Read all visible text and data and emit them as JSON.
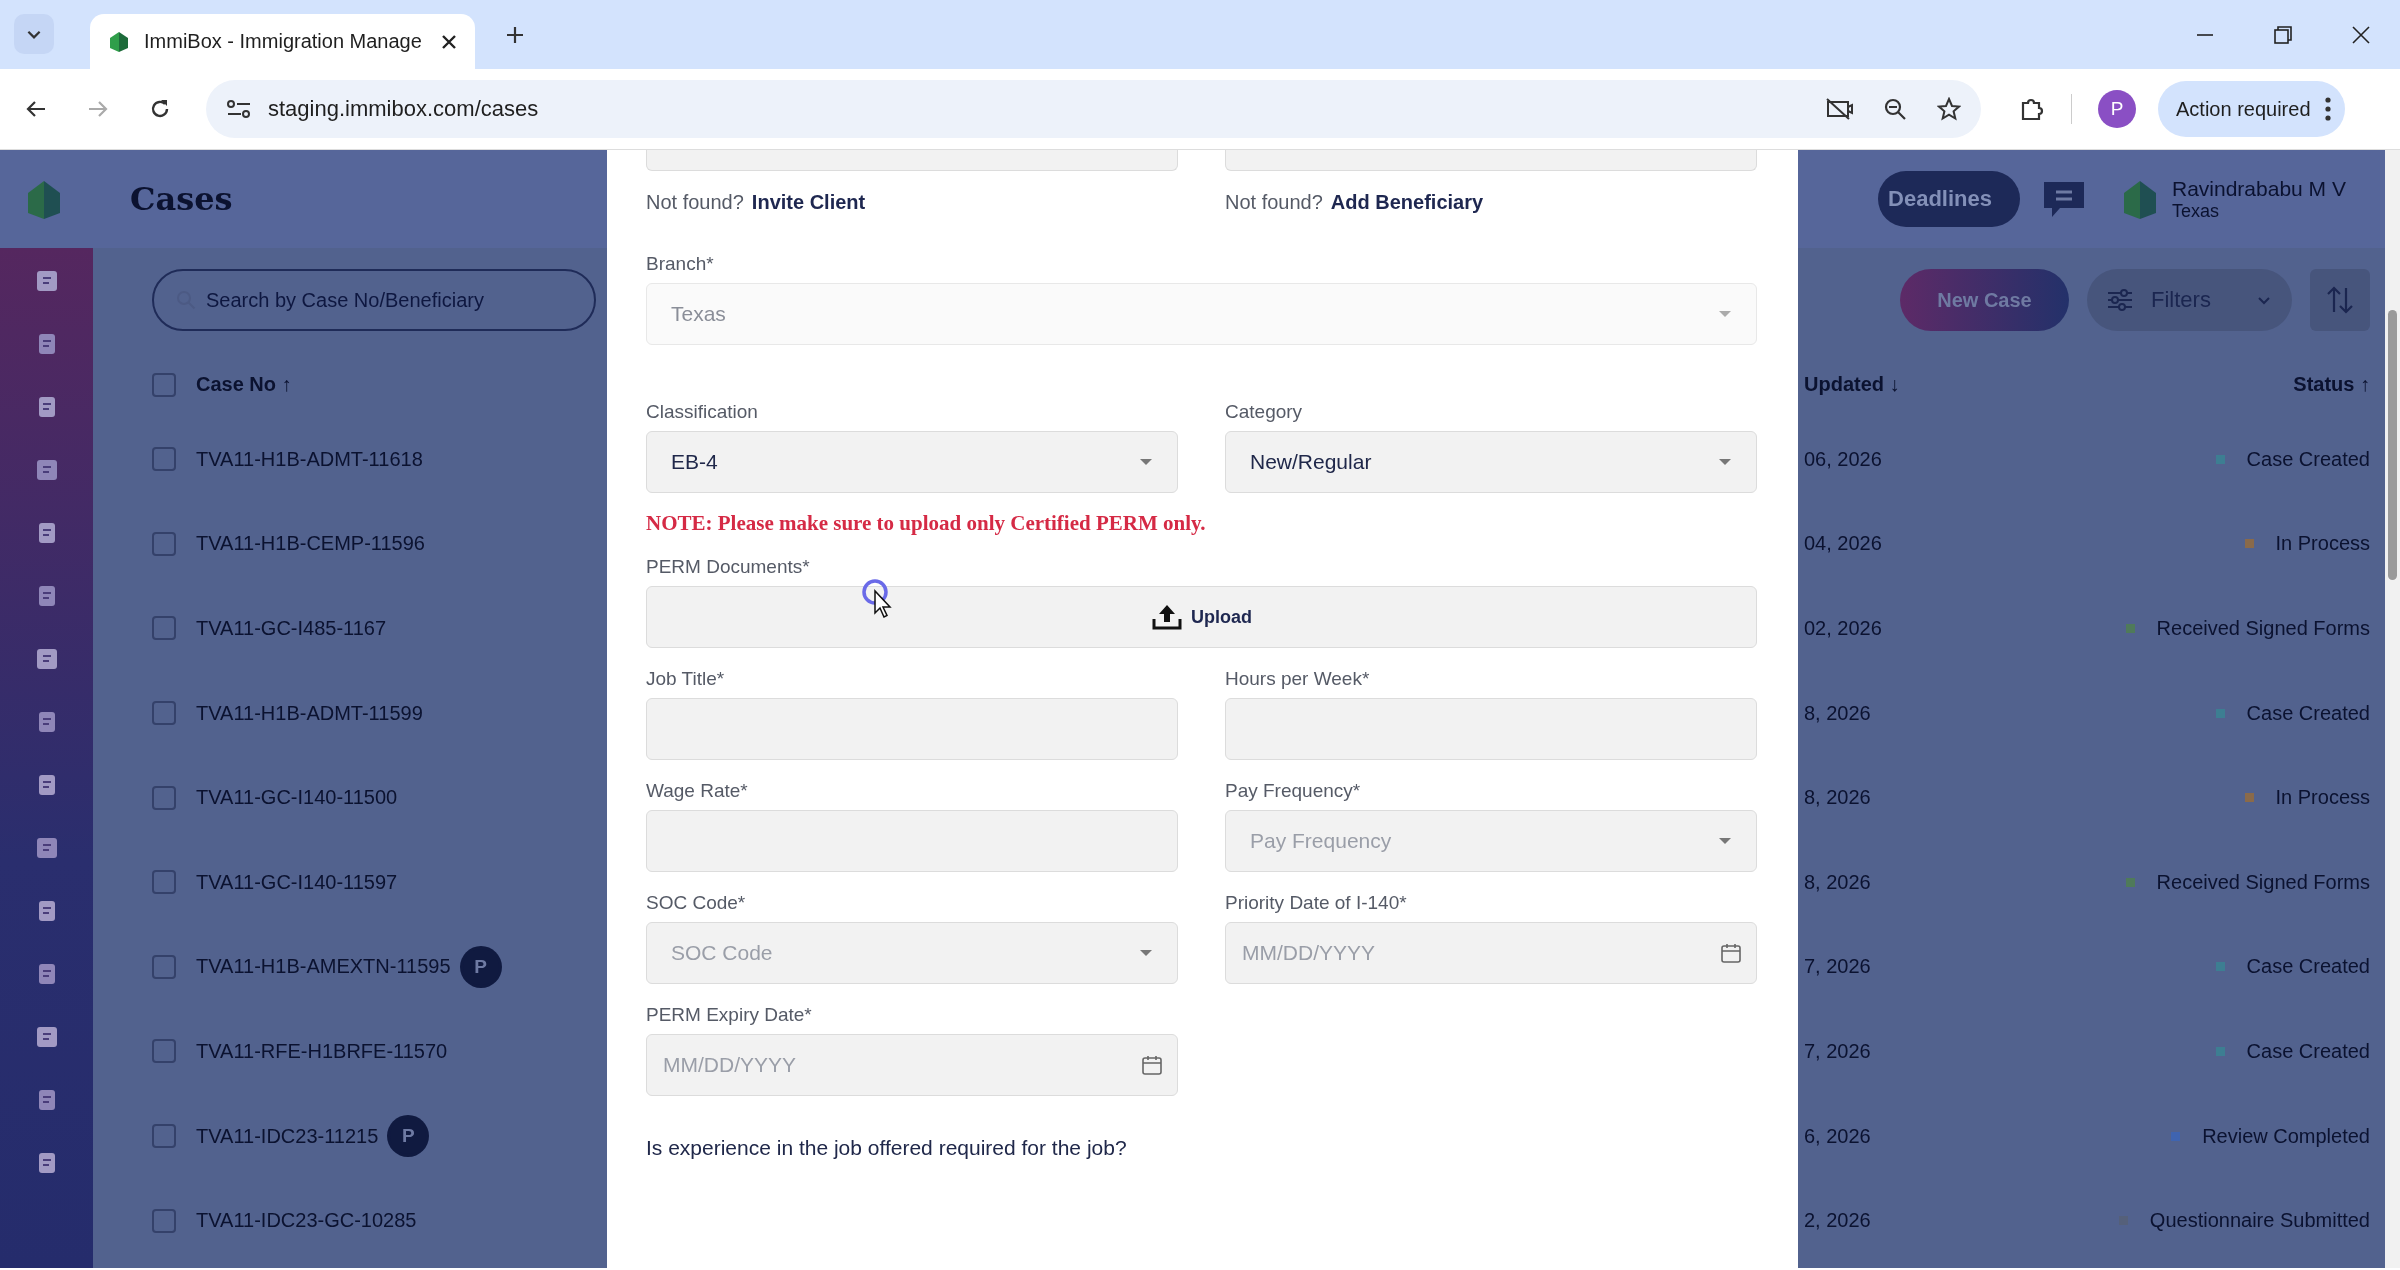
{
  "browser": {
    "tab_title": "ImmiBox - Immigration Manage",
    "url": "staging.immibox.com/cases",
    "profile_initial": "P",
    "action_button": "Action required"
  },
  "app": {
    "title": "Cases",
    "deadlines_button": "Deadlines",
    "user": {
      "name": "Ravindrababu M V",
      "branch": "Texas"
    },
    "search": {
      "placeholder": "Search by Case No/Beneficiary"
    },
    "new_case_button": "New Case",
    "filters_button": "Filters",
    "table": {
      "columns": [
        "Case No ↑",
        "Updated ↓",
        "Status ↑"
      ],
      "all_checked": false,
      "rows": [
        {
          "checked": false,
          "case_no": "TVA11-H1B-ADMT-11618",
          "updated": "06, 2026",
          "status": "Case Created",
          "color": "#3d7e92"
        },
        {
          "checked": false,
          "case_no": "TVA11-H1B-CEMP-11596",
          "updated": "04, 2026",
          "status": "In Process",
          "color": "#8a6a4a"
        },
        {
          "checked": false,
          "case_no": "TVA11-GC-I485-1167",
          "updated": "02, 2026",
          "status": "Received Signed Forms",
          "color": "#4f7a5a"
        },
        {
          "checked": false,
          "case_no": "TVA11-H1B-ADMT-11599",
          "updated": "8, 2026",
          "status": "Case Created",
          "color": "#3d7e92"
        },
        {
          "checked": false,
          "case_no": "TVA11-GC-I140-11500",
          "updated": "8, 2026",
          "status": "In Process",
          "color": "#8a6a4a"
        },
        {
          "checked": false,
          "case_no": "TVA11-GC-I140-11597",
          "updated": "8, 2026",
          "status": "Received Signed Forms",
          "color": "#4f7a5a"
        },
        {
          "checked": false,
          "case_no": "TVA11-H1B-AMEXTN-11595",
          "badge": "P",
          "updated": "7, 2026",
          "status": "Case Created",
          "color": "#3d7e92"
        },
        {
          "checked": false,
          "case_no": "TVA11-RFE-H1BRFE-11570",
          "updated": "7, 2026",
          "status": "Case Created",
          "color": "#3d7e92"
        },
        {
          "checked": false,
          "case_no": "TVA11-IDC23-11215",
          "badge": "P",
          "updated": "6, 2026",
          "status": "Review Completed",
          "color": "#3f64b0"
        },
        {
          "checked": false,
          "case_no": "TVA11-IDC23-GC-10285",
          "updated": "2, 2026",
          "status": "Questionnaire Submitted",
          "color": "#55607a"
        }
      ]
    }
  },
  "modal": {
    "links": [
      {
        "prompt": "Not found?",
        "link": "Invite Client"
      },
      {
        "prompt": "Not found?",
        "link": "Add Beneficiary"
      }
    ],
    "rows": [
      {
        "kind": "wide_field",
        "fields": [
          {
            "label": "Branch*",
            "kind": "select",
            "value": "Texas",
            "disabled": true
          }
        ]
      },
      {
        "kind": "fields",
        "fields": [
          {
            "label": "Classification",
            "kind": "select",
            "value": "EB-4",
            "disabled": false
          },
          {
            "label": "Category",
            "kind": "select",
            "value": "New/Regular",
            "disabled": false
          }
        ]
      },
      {
        "kind": "note",
        "text": "NOTE: Please make sure to upload only Certified PERM only."
      },
      {
        "kind": "wide_field",
        "fields": [
          {
            "label": "PERM Documents*",
            "kind": "upload",
            "value": "Upload",
            "disabled": false
          }
        ]
      },
      {
        "kind": "fields",
        "fields": [
          {
            "label": "Job Title*",
            "kind": "text",
            "disabled": false
          },
          {
            "label": "Hours per Week*",
            "kind": "text",
            "disabled": false
          }
        ]
      },
      {
        "kind": "fields",
        "fields": [
          {
            "label": "Wage Rate*",
            "kind": "text",
            "disabled": false
          },
          {
            "label": "Pay Frequency*",
            "kind": "select",
            "placeholder": "Pay Frequency",
            "disabled": false
          }
        ]
      },
      {
        "kind": "fields",
        "fields": [
          {
            "label": "SOC Code*",
            "kind": "select",
            "placeholder": "SOC Code",
            "disabled": false
          },
          {
            "label": "Priority Date of I-140*",
            "kind": "date",
            "placeholder": "MM/DD/YYYY",
            "disabled": false
          }
        ]
      },
      {
        "kind": "fields",
        "fields": [
          {
            "label": "PERM Expiry Date*",
            "kind": "date",
            "placeholder": "MM/DD/YYYY",
            "disabled": false
          }
        ]
      },
      {
        "kind": "question",
        "text": "Is experience in the job offered required for the job?"
      }
    ]
  }
}
